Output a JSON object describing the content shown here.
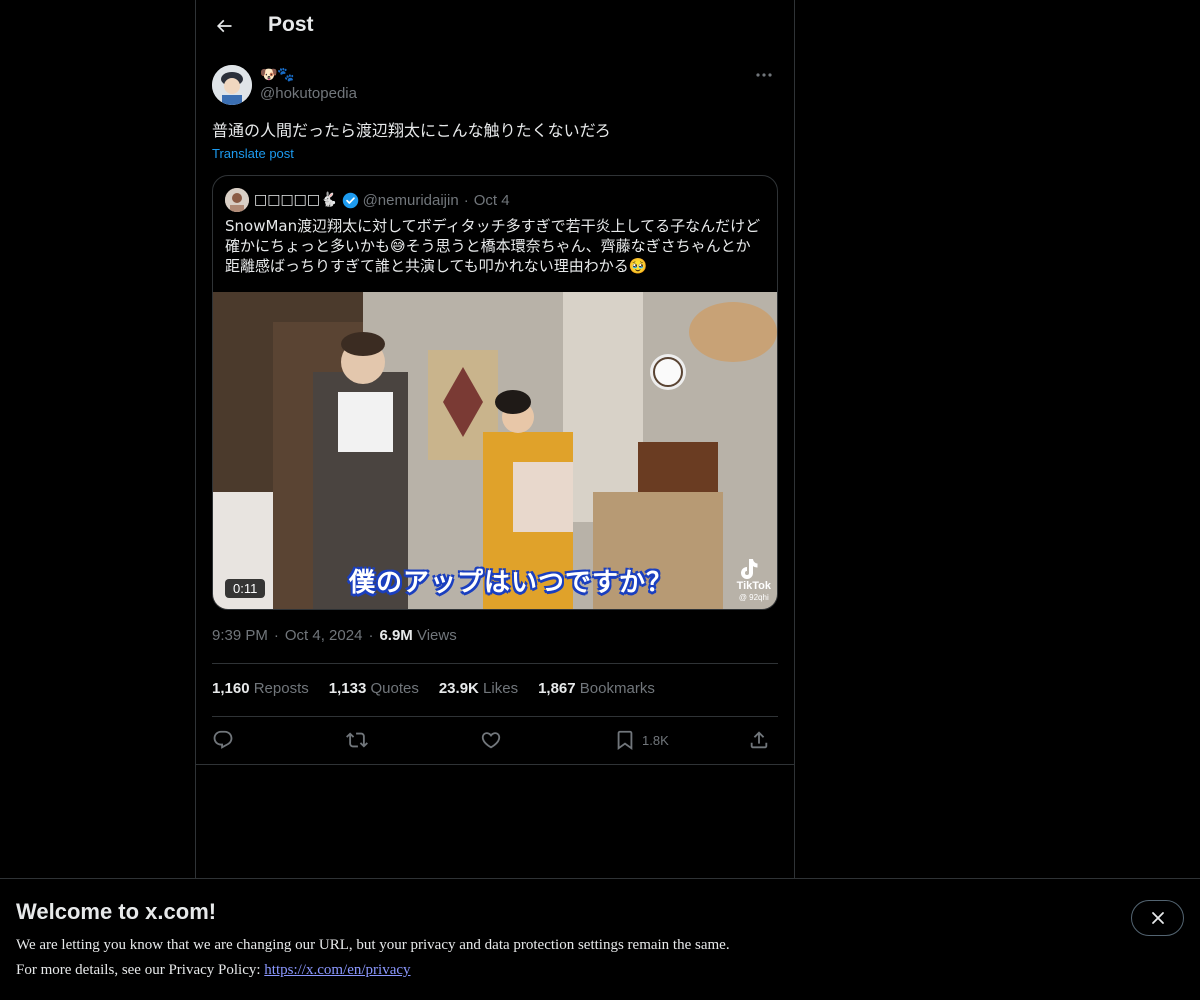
{
  "header": {
    "title": "Post",
    "back_icon": "arrow-left-icon"
  },
  "author": {
    "display_name_emoji": "🐶🐾",
    "handle": "@hokutopedia",
    "more_icon": "more-icon"
  },
  "post": {
    "text": "普通の人間だったら渡辺翔太にこんな触りたくないだろ",
    "translate_label": "Translate post"
  },
  "quote": {
    "name": "□□□□□🐇",
    "handle": "@nemuridaijin",
    "separator": "·",
    "date": "Oct 4",
    "lines": [
      "SnowMan渡辺翔太に対してボディタッチ多すぎで若干炎上してる子なんだけど",
      "確かにちょっと多いかも😅そう思うと橋本環奈ちゃん、齊藤なぎさちゃんとか",
      "距離感ばっちりすぎて誰と共演しても叩かれない理由わかる🥹"
    ],
    "video": {
      "duration": "0:11",
      "caption": "僕のアップはいつですか？",
      "watermark": "TikTok",
      "watermark_handle": "@ 92qhi"
    }
  },
  "meta": {
    "time": "9:39 PM",
    "dot": "·",
    "date": "Oct 4, 2024",
    "views_count": "6.9M",
    "views_label": "Views"
  },
  "stats": {
    "reposts_count": "1,160",
    "reposts_label": "Reposts",
    "quotes_count": "1,133",
    "quotes_label": "Quotes",
    "likes_count": "23.9K",
    "likes_label": "Likes",
    "bookmarks_count": "1,867",
    "bookmarks_label": "Bookmarks"
  },
  "actions": {
    "bookmark_count": "1.8K"
  },
  "banner": {
    "title": "Welcome to x.com!",
    "line1": "We are letting you know that we are changing our URL, but your privacy and data protection settings remain the same.",
    "line2_prefix": "For more details, see our Privacy Policy: ",
    "link": "https://x.com/en/privacy"
  },
  "colors": {
    "accent": "#1d9bf0",
    "background": "#000000",
    "border": "#2f3336",
    "muted": "#71767b",
    "link": "#8b98ff"
  }
}
